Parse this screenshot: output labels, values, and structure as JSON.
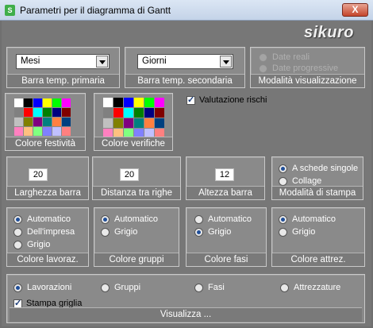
{
  "window": {
    "title": "Parametri per il diagramma di Gantt",
    "close": "X",
    "app_icon": "S",
    "logo": "sikuro"
  },
  "primary": {
    "value": "Mesi",
    "label": "Barra temp. primaria"
  },
  "secondary": {
    "value": "Giorni",
    "label": "Barra temp. secondaria"
  },
  "viewmode": {
    "options": [
      "Date reali",
      "Date progressive"
    ],
    "label": "Modalità visualizzazione"
  },
  "holiday_color": {
    "label": "Colore festività"
  },
  "check_color": {
    "label": "Colore verifiche"
  },
  "risk": {
    "label": "Valutazione rischi",
    "checked": true
  },
  "bar_width": {
    "value": "20",
    "label": "Larghezza barra"
  },
  "row_spacing": {
    "value": "20",
    "label": "Distanza tra righe"
  },
  "bar_height": {
    "value": "12",
    "label": "Altezza barra"
  },
  "print_mode": {
    "options": [
      "A schede singole",
      "Collage"
    ],
    "label": "Modalità di stampa",
    "selected": 0
  },
  "work_color": {
    "options": [
      "Automatico",
      "Dell'impresa",
      "Grigio"
    ],
    "label": "Colore lavoraz.",
    "selected": 0
  },
  "group_color": {
    "options": [
      "Automatico",
      "Grigio"
    ],
    "label": "Colore gruppi",
    "selected": 0
  },
  "phase_color": {
    "options": [
      "Automatico",
      "Grigio"
    ],
    "label": "Colore fasi",
    "selected": 1
  },
  "equip_color": {
    "options": [
      "Automatico",
      "Grigio"
    ],
    "label": "Colore attrez.",
    "selected": 0
  },
  "display": {
    "options": [
      "Lavorazioni",
      "Gruppi",
      "Fasi",
      "Attrezzature"
    ],
    "selected": 0,
    "grid_label": "Stampa griglia",
    "grid_checked": true,
    "label": "Visualizza ..."
  },
  "palette": [
    "#ffffff",
    "#000000",
    "#0000ff",
    "#ffff00",
    "#00ff00",
    "#ff00ff",
    "#808080",
    "#ff0000",
    "#00ffff",
    "#008000",
    "#000080",
    "#800000",
    "#c0c0c0",
    "#808000",
    "#800080",
    "#008080",
    "#ff8040",
    "#004080",
    "#ff80c0",
    "#ffc080",
    "#80ff80",
    "#8080ff",
    "#c0c0ff",
    "#ff8080"
  ]
}
